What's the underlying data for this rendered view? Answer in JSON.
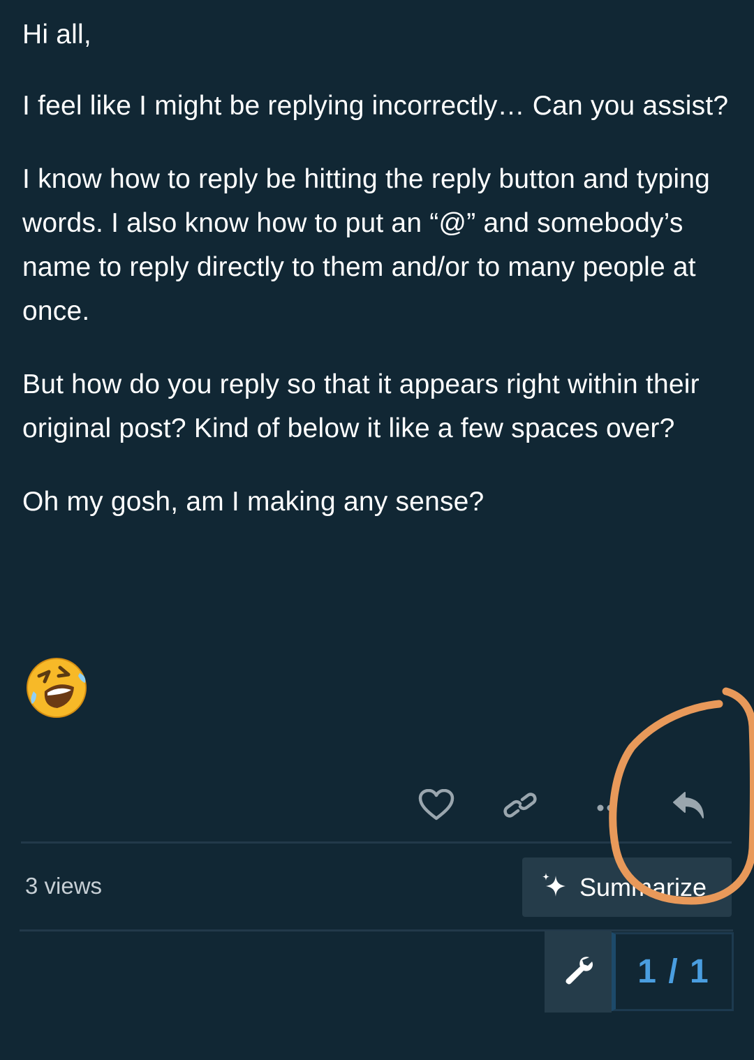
{
  "post": {
    "paragraphs": [
      "Hi all,",
      "I feel like I might be replying incorrectly… Can you assist?",
      "I know how to reply be hitting the reply button and typing words. I also know how to put an “@” and somebody’s name to reply directly to them and/or to many people at once.",
      "But how do you reply so that it appears right within their original post? Kind of below it like a few spaces over?",
      "Oh my gosh, am I making any sense?"
    ],
    "emoji": "rolling-on-the-floor-laughing"
  },
  "actions": {
    "like_icon": "heart-icon",
    "link_icon": "link-icon",
    "more_icon": "ellipsis-icon",
    "reply_icon": "reply-arrow-icon"
  },
  "footer": {
    "views": "3 views",
    "summarize_label": "Summarize",
    "summarize_icon": "sparkle-icon",
    "admin_icon": "wrench-icon",
    "progress": "1 / 1"
  },
  "colors": {
    "background": "#112734",
    "text": "#ffffff",
    "muted_text": "#c7cfd5",
    "icon": "#9aa6ae",
    "button_bg": "#253c4a",
    "accent_blue": "#4a9ee0",
    "annotation": "#e8995a"
  }
}
